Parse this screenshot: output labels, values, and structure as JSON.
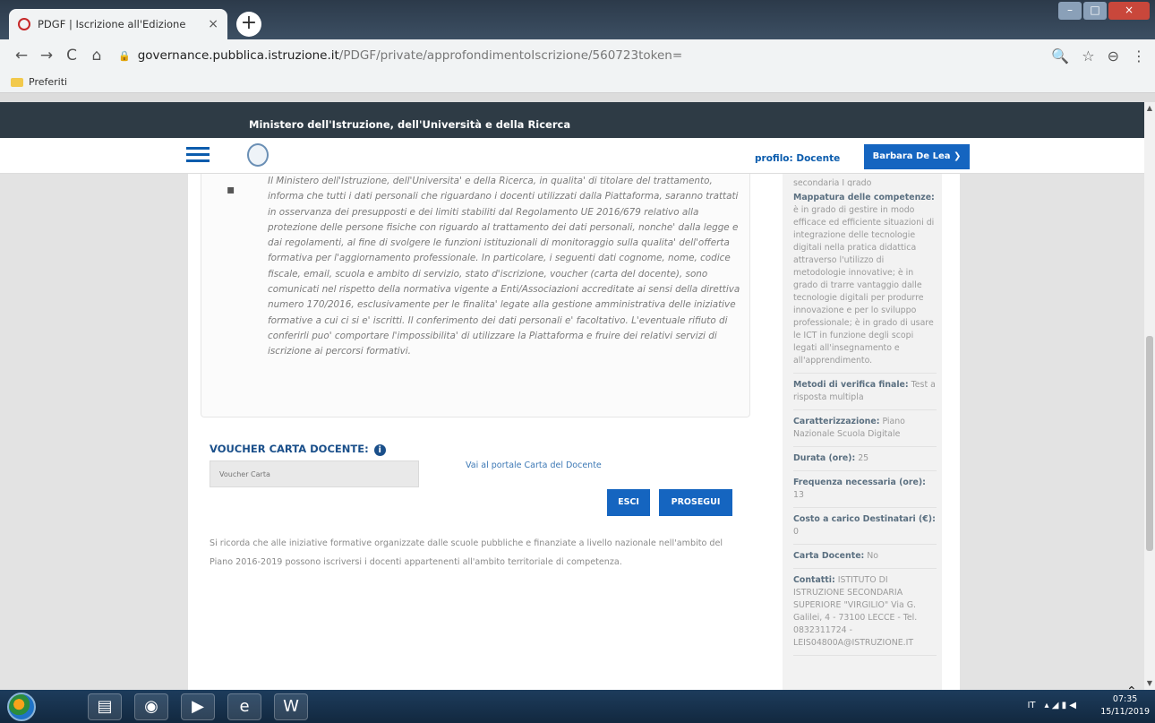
{
  "browser": {
    "tab_title": "PDGF | Iscrizione all'Edizione",
    "tab_close": "×",
    "new_tab": "+",
    "win_min": "–",
    "win_max": "□",
    "win_close": "×",
    "nav": {
      "back": "←",
      "forward": "→",
      "reload": "C",
      "home": "⌂"
    },
    "url_host": "governance.pubblica.istruzione.it",
    "url_path": "/PDGF/private/approfondimentoIscrizione/560723token=",
    "bookmark_folder": "Preferiti",
    "toolbar_icons": {
      "zoom": "🔍",
      "star": "☆",
      "account": "⊖",
      "menu": "⋮"
    }
  },
  "header": {
    "ministry": "Ministero dell'Istruzione, dell'Università e della Ricerca",
    "profile": "profilo: Docente",
    "user_button": "Barbara De Lea"
  },
  "privacy": {
    "bullet": "▪",
    "text": "Il Ministero dell'Istruzione, dell'Universita' e della Ricerca, in qualita' di titolare del trattamento, informa che tutti i dati personali che riguardano i docenti utilizzati dalla Piattaforma, saranno trattati in osservanza dei presupposti e dei limiti stabiliti dal Regolamento UE 2016/679 relativo alla protezione delle persone fisiche con riguardo al trattamento dei dati personali, nonche' dalla legge e dai regolamenti, al fine di svolgere le funzioni istituzionali di monitoraggio sulla qualita' dell'offerta formativa per l'aggiornamento professionale. In particolare, i seguenti dati cognome, nome, codice fiscale, email, scuola e ambito di servizio, stato d'iscrizione, voucher (carta del docente), sono comunicati nel rispetto della normativa vigente a Enti/Associazioni accreditate ai sensi della direttiva numero 170/2016, esclusivamente per le finalita' legate alla gestione amministrativa delle iniziative formative a cui ci si e' iscritti. Il conferimento dei dati personali e' facoltativo. L'eventuale rifiuto di conferirli puo' comportare l'impossibilita' di utilizzare la Piattaforma e fruire dei relativi servizi di iscrizione ai percorsi formativi."
  },
  "voucher": {
    "title": "VOUCHER CARTA DOCENTE:",
    "info_icon": "i",
    "input_placeholder": "Voucher Carta",
    "portal_link": "Vai al portale Carta del Docente",
    "esci": "ESCI",
    "prosegui": "PROSEGUI"
  },
  "note": "Si ricorda che alle iniziative formative organizzate dalle scuole pubbliche e finanziate a livello nazionale nell'ambito del Piano 2016-2019 possono iscriversi i docenti appartenenti all'ambito territoriale di competenza.",
  "side_panel": {
    "cut_text": "secondaria I grado",
    "rows": [
      {
        "label": "Mappatura delle competenze:",
        "value": "è in grado di gestire in modo efficace ed efficiente situazioni di integrazione delle tecnologie digitali nella pratica didattica attraverso l'utilizzo di metodologie innovative; è in grado di trarre vantaggio dalle tecnologie digitali per produrre innovazione e per lo sviluppo professionale; è in grado di usare le ICT in funzione degli scopi legati all'insegnamento e all'apprendimento."
      },
      {
        "label": "Metodi di verifica finale:",
        "value": "Test a risposta multipla"
      },
      {
        "label": "Caratterizzazione:",
        "value": "Piano Nazionale Scuola Digitale"
      },
      {
        "label": "Durata (ore):",
        "value": "25"
      },
      {
        "label": "Frequenza necessaria (ore):",
        "value": "13"
      },
      {
        "label": "Costo a carico Destinatari (€):",
        "value": "0"
      },
      {
        "label": "Carta Docente:",
        "value": "No"
      },
      {
        "label": "Contatti:",
        "value": "ISTITUTO DI ISTRUZIONE SECONDARIA SUPERIORE \"VIRGILIO\" Via G. Galilei, 4 - 73100 LECCE - Tel. 0832311724 - LEIS04800A@ISTRUZIONE.IT"
      }
    ]
  },
  "scroll": {
    "up": "▲",
    "down": "▼",
    "back_to_top": "⌃"
  },
  "taskbar": {
    "apps": {
      "explorer": "▤",
      "chrome": "◉",
      "media": "▶",
      "ie": "e",
      "word": "W"
    },
    "lang": "IT",
    "tray_icons": "▴ ◢ ▮ ◀",
    "time": "07:35",
    "date": "15/11/2019"
  }
}
